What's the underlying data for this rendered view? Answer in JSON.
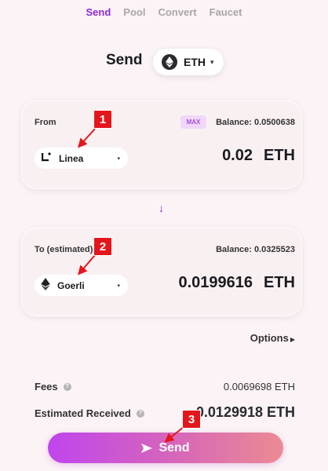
{
  "nav": {
    "tabs": [
      {
        "label": "Send",
        "active": true
      },
      {
        "label": "Pool",
        "active": false
      },
      {
        "label": "Convert",
        "active": false
      },
      {
        "label": "Faucet",
        "active": false
      }
    ]
  },
  "header": {
    "title": "Send",
    "token": "ETH",
    "token_icon": "ethereum-icon"
  },
  "from": {
    "label": "From",
    "max_label": "MAX",
    "balance": "Balance: 0.0500638",
    "chain": "Linea",
    "chain_icon": "linea-icon",
    "amount": "0.02",
    "unit": "ETH"
  },
  "to": {
    "label": "To (estimated)",
    "balance": "Balance: 0.0325523",
    "chain": "Goerli",
    "chain_icon": "ethereum-icon",
    "amount": "0.0199616",
    "unit": "ETH"
  },
  "options_label": "Options",
  "summary": {
    "fees_label": "Fees",
    "fees_value": "0.0069698 ETH",
    "received_label": "Estimated Received",
    "received_value": "0.0129918 ETH"
  },
  "send_button_label": "Send",
  "annotations": [
    "1",
    "2",
    "3"
  ],
  "colors": {
    "accent": "#8f2ad8",
    "marker": "#e4161c",
    "button_gradient": [
      "#c045ee",
      "#eb8b93"
    ]
  }
}
